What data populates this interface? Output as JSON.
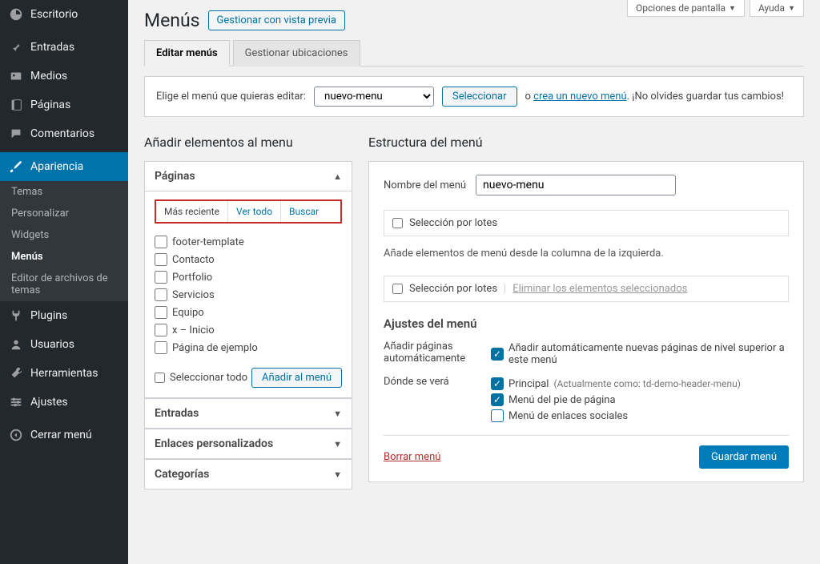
{
  "screen_options": "Opciones de pantalla",
  "help": "Ayuda",
  "sidebar": {
    "items": [
      {
        "label": "Escritorio"
      },
      {
        "label": "Entradas"
      },
      {
        "label": "Medios"
      },
      {
        "label": "Páginas"
      },
      {
        "label": "Comentarios"
      },
      {
        "label": "Apariencia"
      },
      {
        "label": "Plugins"
      },
      {
        "label": "Usuarios"
      },
      {
        "label": "Herramientas"
      },
      {
        "label": "Ajustes"
      },
      {
        "label": "Cerrar menú"
      }
    ],
    "submenu": [
      {
        "label": "Temas"
      },
      {
        "label": "Personalizar"
      },
      {
        "label": "Widgets"
      },
      {
        "label": "Menús"
      },
      {
        "label": "Editor de archivos de temas"
      }
    ]
  },
  "page": {
    "title": "Menús",
    "preview_btn": "Gestionar con vista previa",
    "tab_edit": "Editar menús",
    "tab_locations": "Gestionar ubicaciones",
    "select_label": "Elige el menú que quieras editar:",
    "select_value": "nuevo-menu",
    "select_btn": "Seleccionar",
    "or_text": "o",
    "create_link": "crea un nuevo menú",
    "remember": ". ¡No olvides guardar tus cambios!"
  },
  "add": {
    "heading": "Añadir elementos al menu",
    "paginas": "Páginas",
    "tabs": {
      "recent": "Más reciente",
      "all": "Ver todo",
      "search": "Buscar"
    },
    "pages": [
      "footer-template",
      "Contacto",
      "Portfolio",
      "Servicios",
      "Equipo",
      "x – Inicio",
      "Página de ejemplo"
    ],
    "select_all": "Seleccionar todo",
    "add_btn": "Añadir al menú",
    "entradas": "Entradas",
    "custom_links": "Enlaces personalizados",
    "categorias": "Categorías"
  },
  "structure": {
    "heading": "Estructura del menú",
    "name_label": "Nombre del menú",
    "name_value": "nuevo-menu",
    "bulk_select": "Selección por lotes",
    "instruction": "Añade elementos de menú desde la columna de la izquierda.",
    "remove_selected": "Eliminar los elementos seleccionados",
    "settings_heading": "Ajustes del menú",
    "auto_label": "Añadir páginas automáticamente",
    "auto_opt": "Añadir automáticamente nuevas páginas de nivel superior a este menú",
    "where_label": "Dónde se verá",
    "loc1": "Principal",
    "loc1_note": "(Actualmente como: td-demo-header-menu)",
    "loc2": "Menú del pie de página",
    "loc3": "Menú de enlaces sociales",
    "delete": "Borrar menú",
    "save": "Guardar menú"
  }
}
